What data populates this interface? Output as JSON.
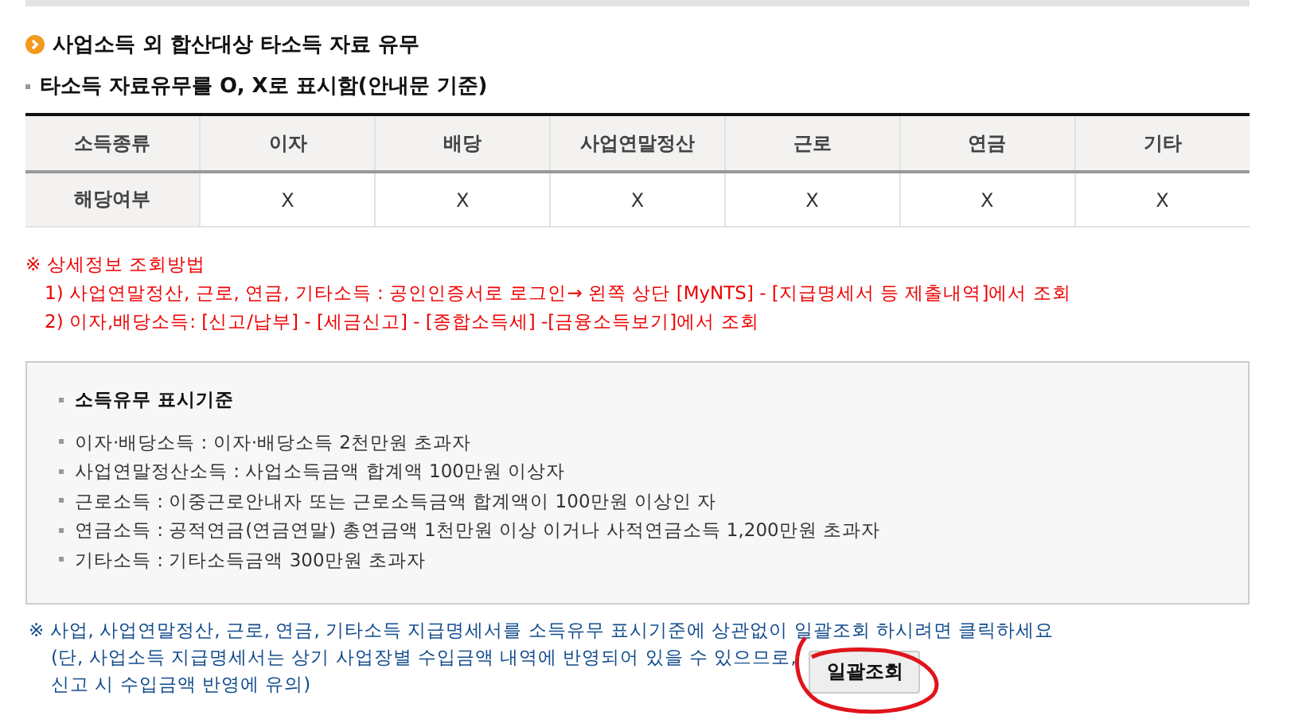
{
  "heading": "사업소득 외 합산대상 타소득 자료 유무",
  "subheading": "타소득 자료유무를 O, X로 표시함(안내문 기준)",
  "table": {
    "columns": [
      "소득종류",
      "이자",
      "배당",
      "사업연말정산",
      "근로",
      "연금",
      "기타"
    ],
    "rows": [
      [
        "해당여부",
        "X",
        "X",
        "X",
        "X",
        "X",
        "X"
      ]
    ]
  },
  "notice": {
    "title": "※  상세정보 조회방법",
    "lines": [
      "1) 사업연말정산, 근로, 연금, 기타소득 : 공인인증서로 로그인→ 왼쪽 상단 [MyNTS] - [지급명세서 등 제출내역]에서 조회",
      "2) 이자,배당소득: [신고/납부] - [세금신고] - [종합소득세] -[금융소득보기]에서 조회"
    ]
  },
  "criteria": {
    "title": "소득유무 표시기준",
    "items": [
      "이자·배당소득 : 이자·배당소득 2천만원 초과자",
      "사업연말정산소득 : 사업소득금액 합계액 100만원 이상자",
      "근로소득 : 이중근로안내자 또는 근로소득금액 합계액이 100만원 이상인 자",
      "연금소득 : 공적연금(연금연말) 총연금액 1천만원 이상 이거나 사적연금소득 1,200만원 초과자",
      "기타소득 : 기타소득금액 300만원 초과자"
    ]
  },
  "footer": {
    "text": "※ 사업, 사업연말정산, 근로, 연금, 기타소득 지급명세서를 소득유무 표시기준에 상관없이 일괄조회 하시려면 클릭하세요",
    "note_lines": [
      "(단, 사업소득 지급명세서는 상기 사업장별 수입금액 내역에 반영되어 있을 수 있으므로,",
      "신고 시 수입금액 반영에 유의)"
    ],
    "button": "일괄조회"
  }
}
